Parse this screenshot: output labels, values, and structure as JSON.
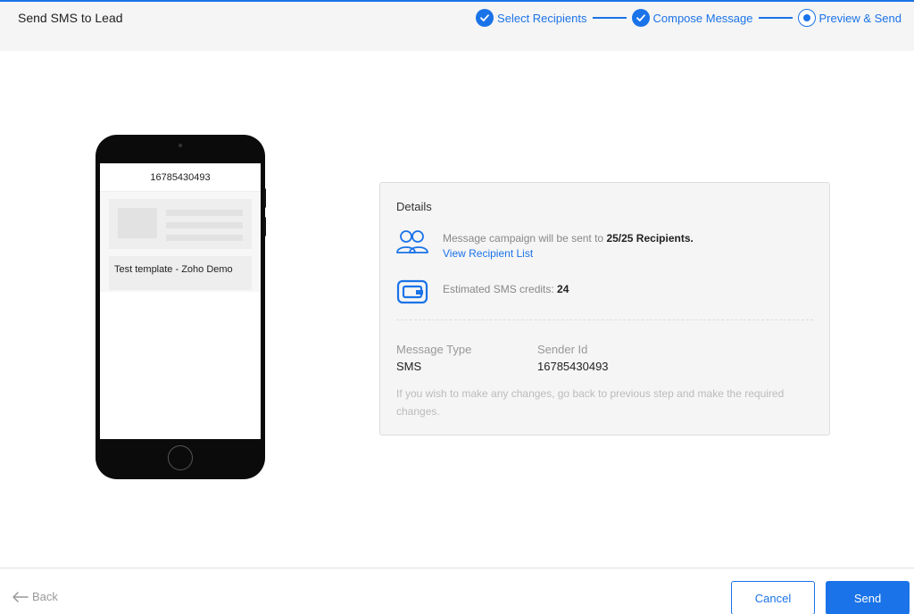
{
  "header": {
    "title": "Send SMS to Lead",
    "steps": [
      {
        "label": "Select Recipients",
        "state": "done"
      },
      {
        "label": "Compose Message",
        "state": "done"
      },
      {
        "label": "Preview & Send",
        "state": "current"
      }
    ]
  },
  "preview": {
    "phone_number": "16785430493",
    "message": "Test template - Zoho Demo"
  },
  "details": {
    "title": "Details",
    "recipients_prefix": "Message campaign will be sent to ",
    "recipients_count": "25/25 Recipients.",
    "view_list_link": "View Recipient List",
    "credits_prefix": "Estimated SMS credits: ",
    "credits_value": "24",
    "message_type_label": "Message Type",
    "message_type_value": "SMS",
    "sender_id_label": "Sender Id",
    "sender_id_value": "16785430493",
    "note": "If you wish to make any changes, go back to previous step and make the required changes."
  },
  "footer": {
    "back_label": "Back",
    "cancel_label": "Cancel",
    "send_label": "Send"
  },
  "colors": {
    "accent": "#1a73e8",
    "header_bg": "#f5f5f5"
  }
}
